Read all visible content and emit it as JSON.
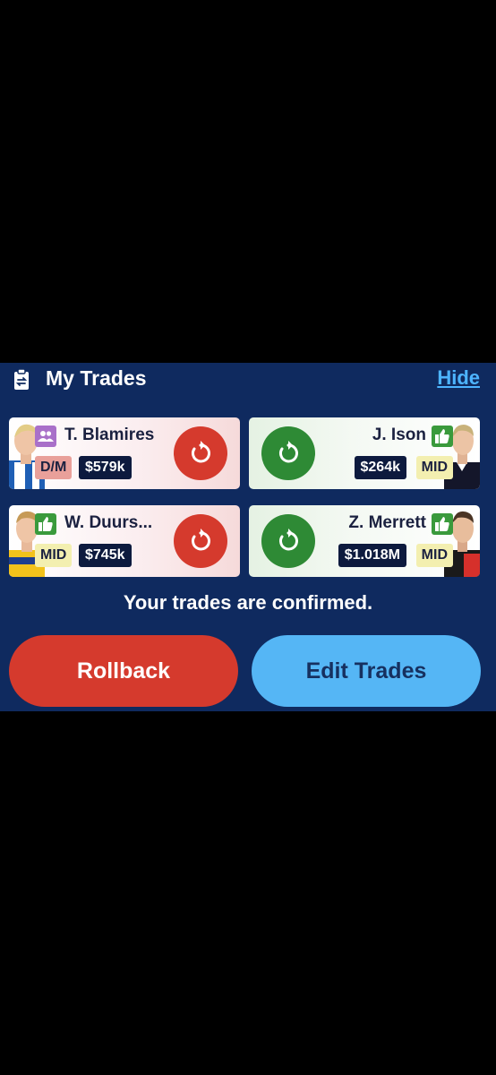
{
  "header": {
    "title": "My Trades",
    "hide_label": "Hide"
  },
  "trades": [
    {
      "out": {
        "name": "T. Blamires",
        "position": "D/M",
        "price": "$579k",
        "status_icon": "people-icon",
        "status_color": "#a970c9"
      },
      "in": {
        "name": "J. Ison",
        "position": "MID",
        "price": "$264k",
        "status_icon": "thumbs-up-icon",
        "status_color": "#3a9a3c"
      }
    },
    {
      "out": {
        "name": "W. Duurs...",
        "position": "MID",
        "price": "$745k",
        "status_icon": "thumbs-up-icon",
        "status_color": "#3a9a3c"
      },
      "in": {
        "name": "Z. Merrett",
        "position": "MID",
        "price": "$1.018M",
        "status_icon": "thumbs-up-icon",
        "status_color": "#3a9a3c"
      }
    }
  ],
  "status_message": "Your trades are confirmed.",
  "buttons": {
    "rollback": "Rollback",
    "edit": "Edit Trades"
  },
  "colors": {
    "panel": "#0f2a5f",
    "red": "#d53a2d",
    "green": "#2e8a35",
    "blue": "#55b6f5"
  }
}
